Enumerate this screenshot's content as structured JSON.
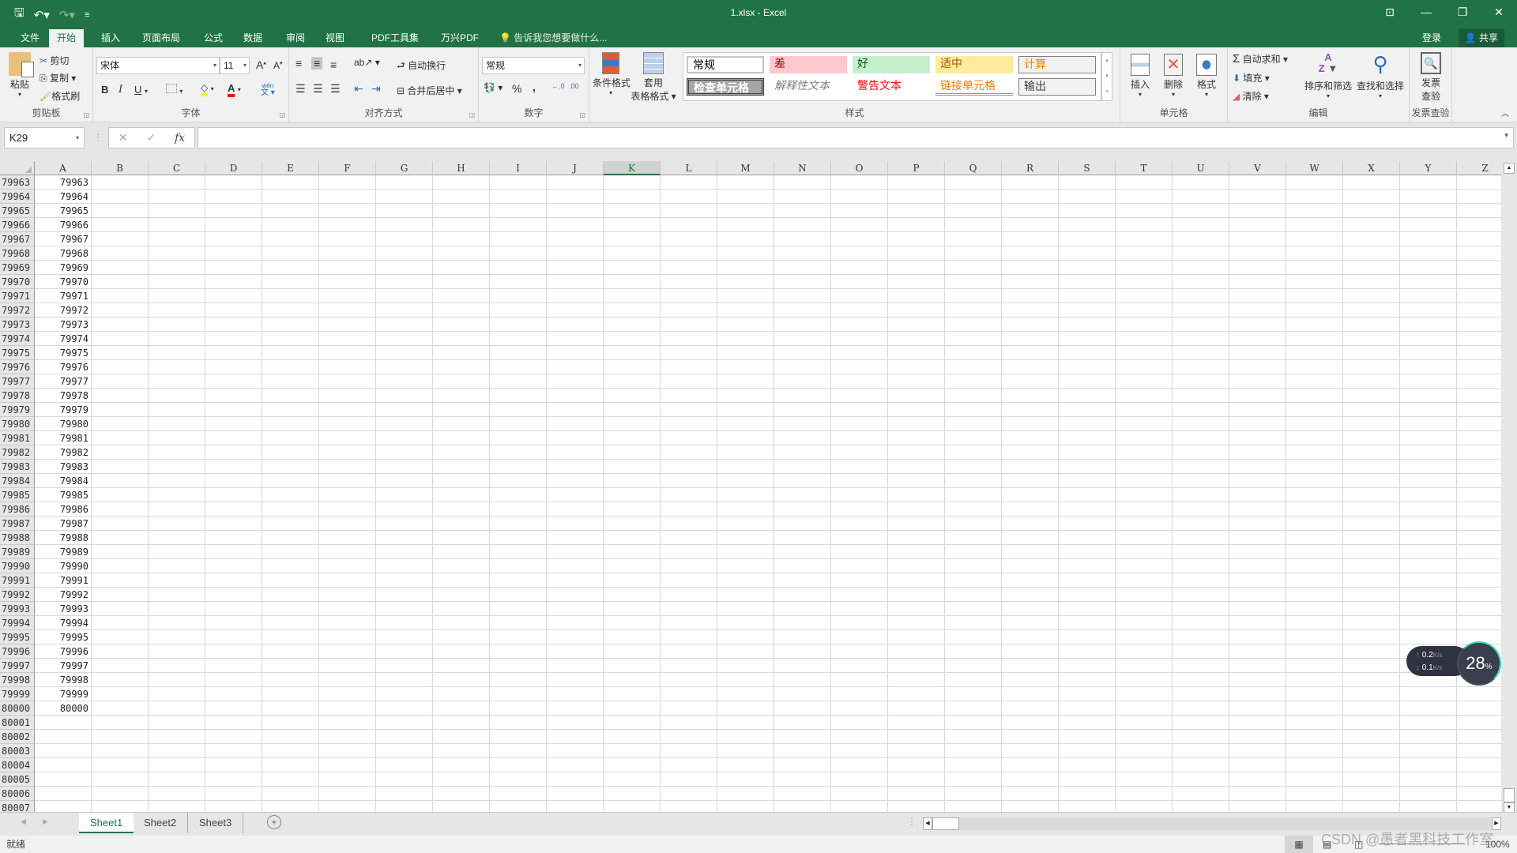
{
  "window": {
    "title": "1.xlsx - Excel"
  },
  "qat": {
    "save": "save-icon",
    "undo": "undo-icon",
    "redo": "redo-icon",
    "customize": "customize-icon"
  },
  "tabs": [
    {
      "label": "文件"
    },
    {
      "label": "开始"
    },
    {
      "label": "插入"
    },
    {
      "label": "页面布局"
    },
    {
      "label": "公式"
    },
    {
      "label": "数据"
    },
    {
      "label": "审阅"
    },
    {
      "label": "视图"
    },
    {
      "label": "PDF工具集"
    },
    {
      "label": "万兴PDF"
    }
  ],
  "tellme": "告诉我您想要做什么...",
  "account": {
    "login": "登录",
    "share": "共享"
  },
  "ribbon": {
    "clipboard": {
      "label": "剪贴板",
      "paste": "粘贴",
      "cut": "剪切",
      "copy": "复制",
      "format_painter": "格式刷"
    },
    "font": {
      "label": "字体",
      "name": "宋体",
      "size": "11",
      "bold": "B",
      "italic": "I",
      "underline": "U",
      "fill_color": "#ffff00",
      "font_color": "#ff0000",
      "phonetic": "wén"
    },
    "alignment": {
      "label": "对齐方式",
      "wrap": "自动换行",
      "merge": "合并后居中"
    },
    "number": {
      "label": "数字",
      "format": "常规",
      "percent": "%",
      "comma": ","
    },
    "styles": {
      "label": "样式",
      "conditional": "条件格式",
      "table_l1": "套用",
      "table_l2": "表格格式",
      "cells": [
        {
          "text": "常规",
          "bg": "#ffffff",
          "fg": "#000000"
        },
        {
          "text": "差",
          "bg": "#ffc7ce",
          "fg": "#9c0006"
        },
        {
          "text": "好",
          "bg": "#c6efce",
          "fg": "#006100"
        },
        {
          "text": "适中",
          "bg": "#ffeb9c",
          "fg": "#9c5700"
        },
        {
          "text": "计算",
          "bg": "#f2f2f2",
          "fg": "#fa7d00"
        },
        {
          "text": "检查单元格",
          "bg": "#a5a5a5",
          "fg": "#ffffff"
        },
        {
          "text": "解释性文本",
          "bg": "#ffffff",
          "fg": "#7f7f7f"
        },
        {
          "text": "警告文本",
          "bg": "#ffffff",
          "fg": "#ff0000"
        },
        {
          "text": "链接单元格",
          "bg": "#ffffff",
          "fg": "#fa7d00"
        },
        {
          "text": "输出",
          "bg": "#f2f2f2",
          "fg": "#3f3f3f"
        }
      ]
    },
    "cells": {
      "label": "单元格",
      "insert": "插入",
      "delete": "删除",
      "format": "格式"
    },
    "editing": {
      "label": "编辑",
      "autosum": "自动求和",
      "fill": "填充",
      "clear": "清除",
      "sort": "排序和筛选",
      "find": "查找和选择"
    },
    "invoice": {
      "label": "发票查验",
      "btn_l1": "发票",
      "btn_l2": "查验"
    }
  },
  "formula_bar": {
    "name_box": "K29",
    "formula": "",
    "fx": "fx"
  },
  "columns": [
    "A",
    "B",
    "C",
    "D",
    "E",
    "F",
    "G",
    "H",
    "I",
    "J",
    "K",
    "L",
    "M",
    "N",
    "O",
    "P",
    "Q",
    "R",
    "S",
    "T",
    "U",
    "V",
    "W",
    "X",
    "Y",
    "Z"
  ],
  "selected_column": "K",
  "rows": {
    "start": 79963,
    "end": 80007,
    "last_value_row": 80000
  },
  "sheets": [
    {
      "label": "Sheet1",
      "active": true
    },
    {
      "label": "Sheet2"
    },
    {
      "label": "Sheet3"
    }
  ],
  "status": {
    "ready": "就绪",
    "zoom": "100%"
  },
  "net_widget": {
    "up": "0.2",
    "down": "0.1",
    "unit": "K/s",
    "percent": "28",
    "percent_sign": "%"
  },
  "watermark": "CSDN @愚者黑科技工作室"
}
